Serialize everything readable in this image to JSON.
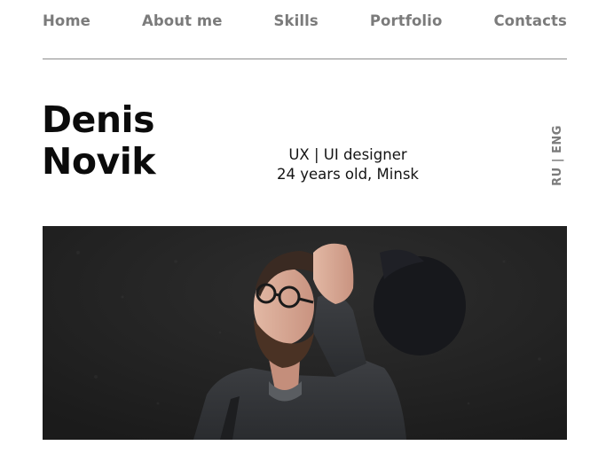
{
  "nav": {
    "items": [
      {
        "label": "Home"
      },
      {
        "label": "About me"
      },
      {
        "label": "Skills"
      },
      {
        "label": "Portfolio"
      },
      {
        "label": "Contacts"
      }
    ]
  },
  "hero": {
    "first_name": "Denis",
    "last_name": "Novik",
    "role": "UX | UI designer",
    "info": "24 years old, Minsk",
    "language_switch": "RU | ENG"
  },
  "photo": {
    "subject": "portrait-photo"
  },
  "colors": {
    "nav_text": "#7b7b7b",
    "name_text": "#0b0b0b",
    "divider": "#8c8c8c",
    "photo_bg": "#242424"
  }
}
